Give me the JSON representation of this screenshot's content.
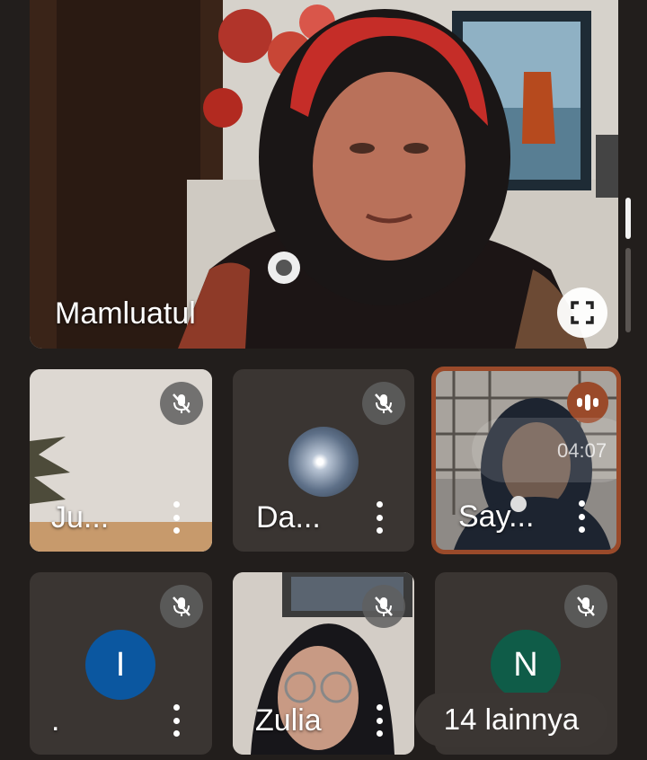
{
  "main_speaker": {
    "name": "Mamluatul"
  },
  "participants": [
    {
      "name": "Ju..."
    },
    {
      "name": "Da..."
    },
    {
      "name": "Say...",
      "timestamp": "04:07"
    },
    {
      "name": ".",
      "initial": "I",
      "avatar_color": "#0b57a0"
    },
    {
      "name": "Zulia"
    },
    {
      "name": "",
      "initial": "N",
      "avatar_color": "#0f5c48"
    }
  ],
  "more_chip": {
    "label": "14 lainnya"
  },
  "icons": {
    "mic_off": "mic-off-icon",
    "more": "more-vert-icon",
    "fullscreen": "fullscreen-icon",
    "speaking": "audio-level-icon"
  },
  "colors": {
    "background": "#221e1c",
    "active_speaker_border": "#9a4a2a",
    "mic_badge": "#5f5f5f"
  }
}
